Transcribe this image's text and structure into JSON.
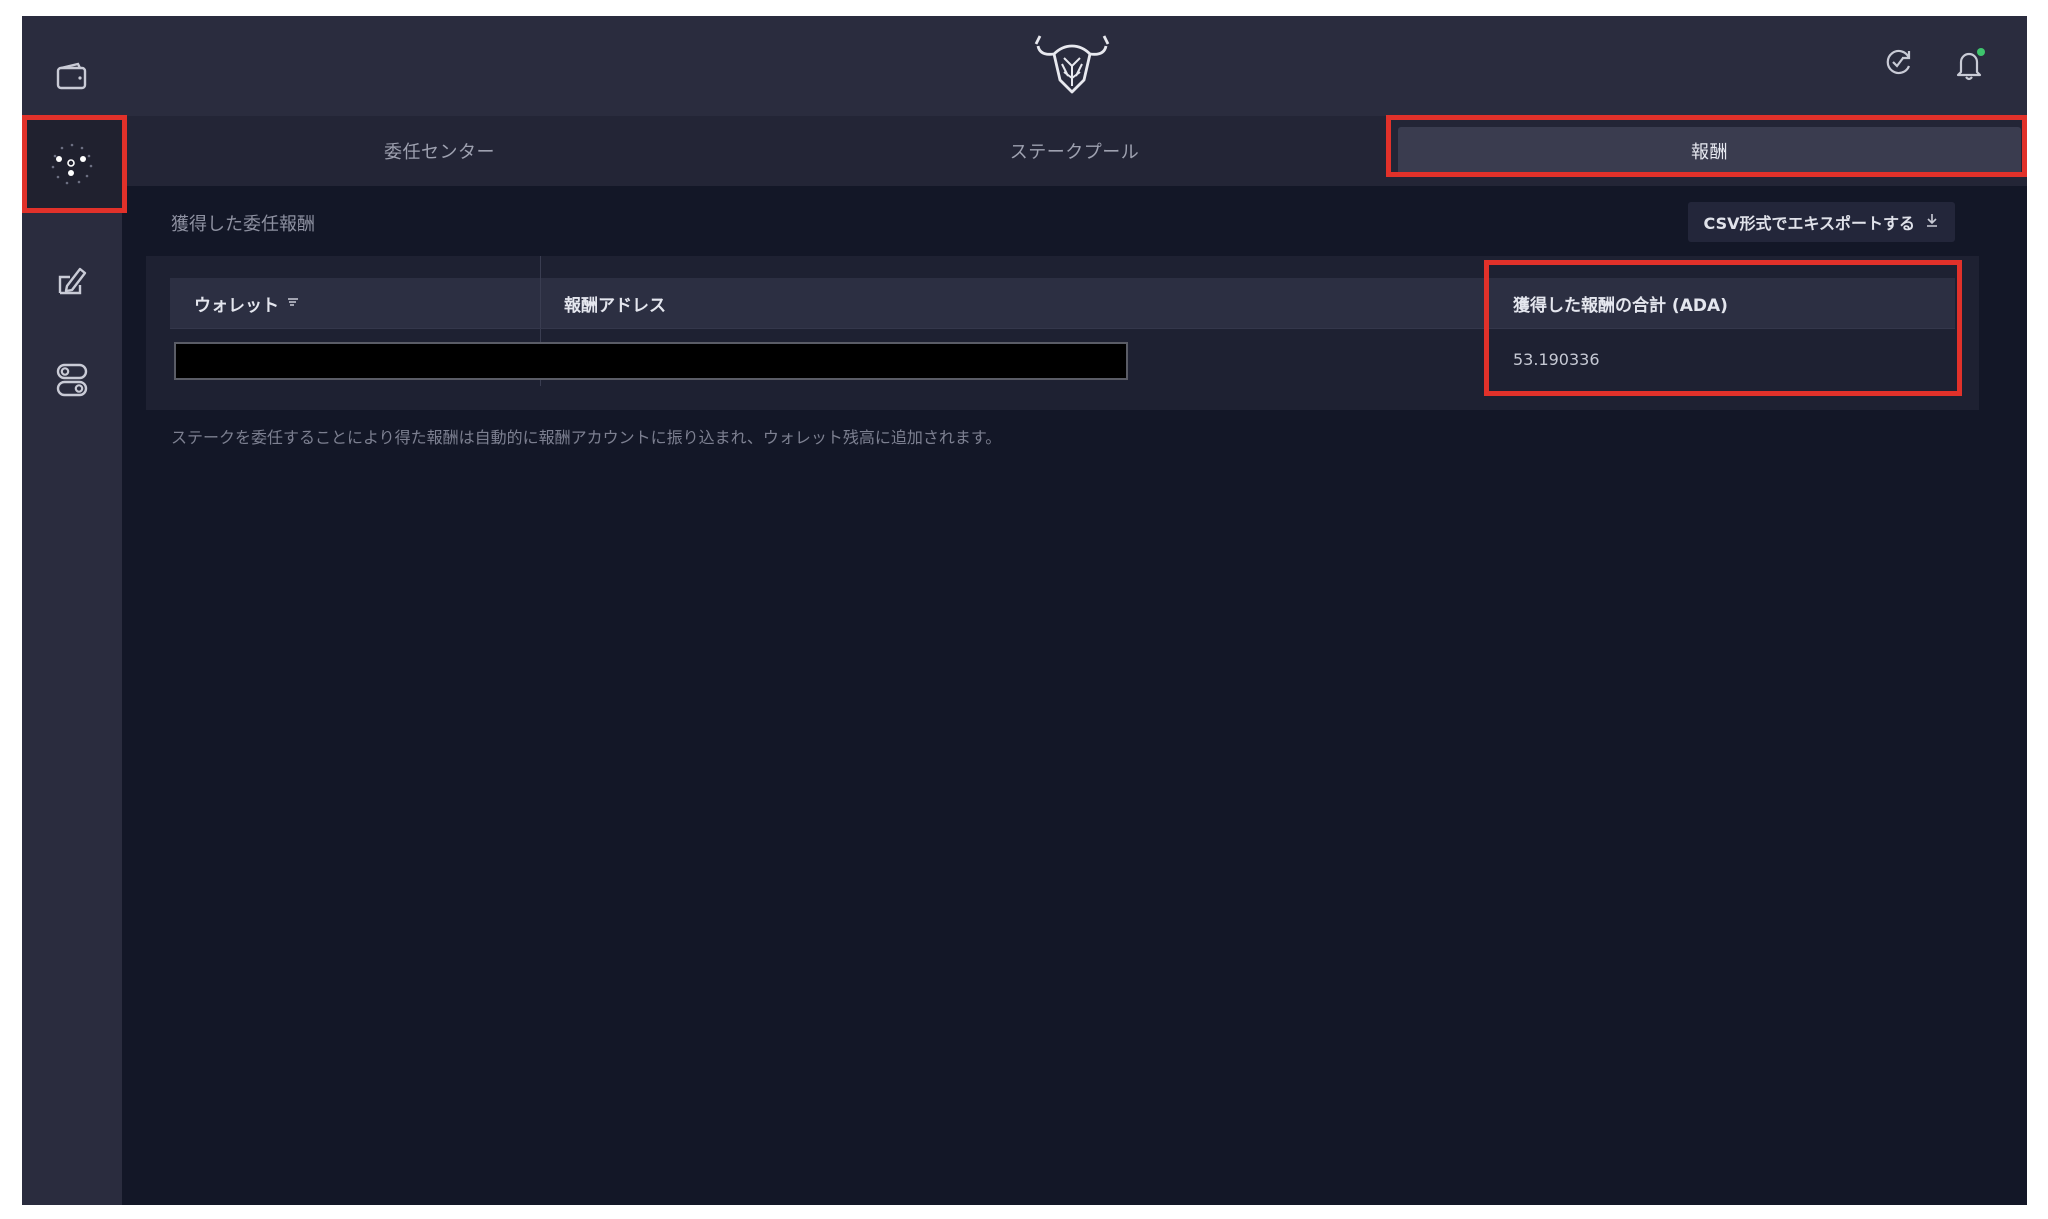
{
  "tabs": [
    {
      "label": "委任センター",
      "active": false
    },
    {
      "label": "ステークプール",
      "active": false
    },
    {
      "label": "報酬",
      "active": true
    }
  ],
  "rewards": {
    "title": "獲得した委任報酬",
    "export_label": "CSV形式でエキスポートする",
    "columns": {
      "wallet": "ウォレット",
      "address": "報酬アドレス",
      "total": "獲得した報酬の合計 (ADA)"
    },
    "rows": [
      {
        "total": "53.190336"
      }
    ],
    "note": "ステークを委任することにより得た報酬は自動的に報酬アカウントに振り込まれ、ウォレット残高に追加されます。"
  },
  "icons": {
    "sidebar": [
      "wallet-icon",
      "delegation-icon",
      "voting-icon",
      "settings-icon"
    ],
    "topbar": [
      "sync-icon",
      "notification-bell-icon"
    ]
  },
  "colors": {
    "background": "#131727",
    "sidebar": "#2a2c3e",
    "highlight": "#e1312a",
    "notification_dot": "#3ec46d"
  }
}
